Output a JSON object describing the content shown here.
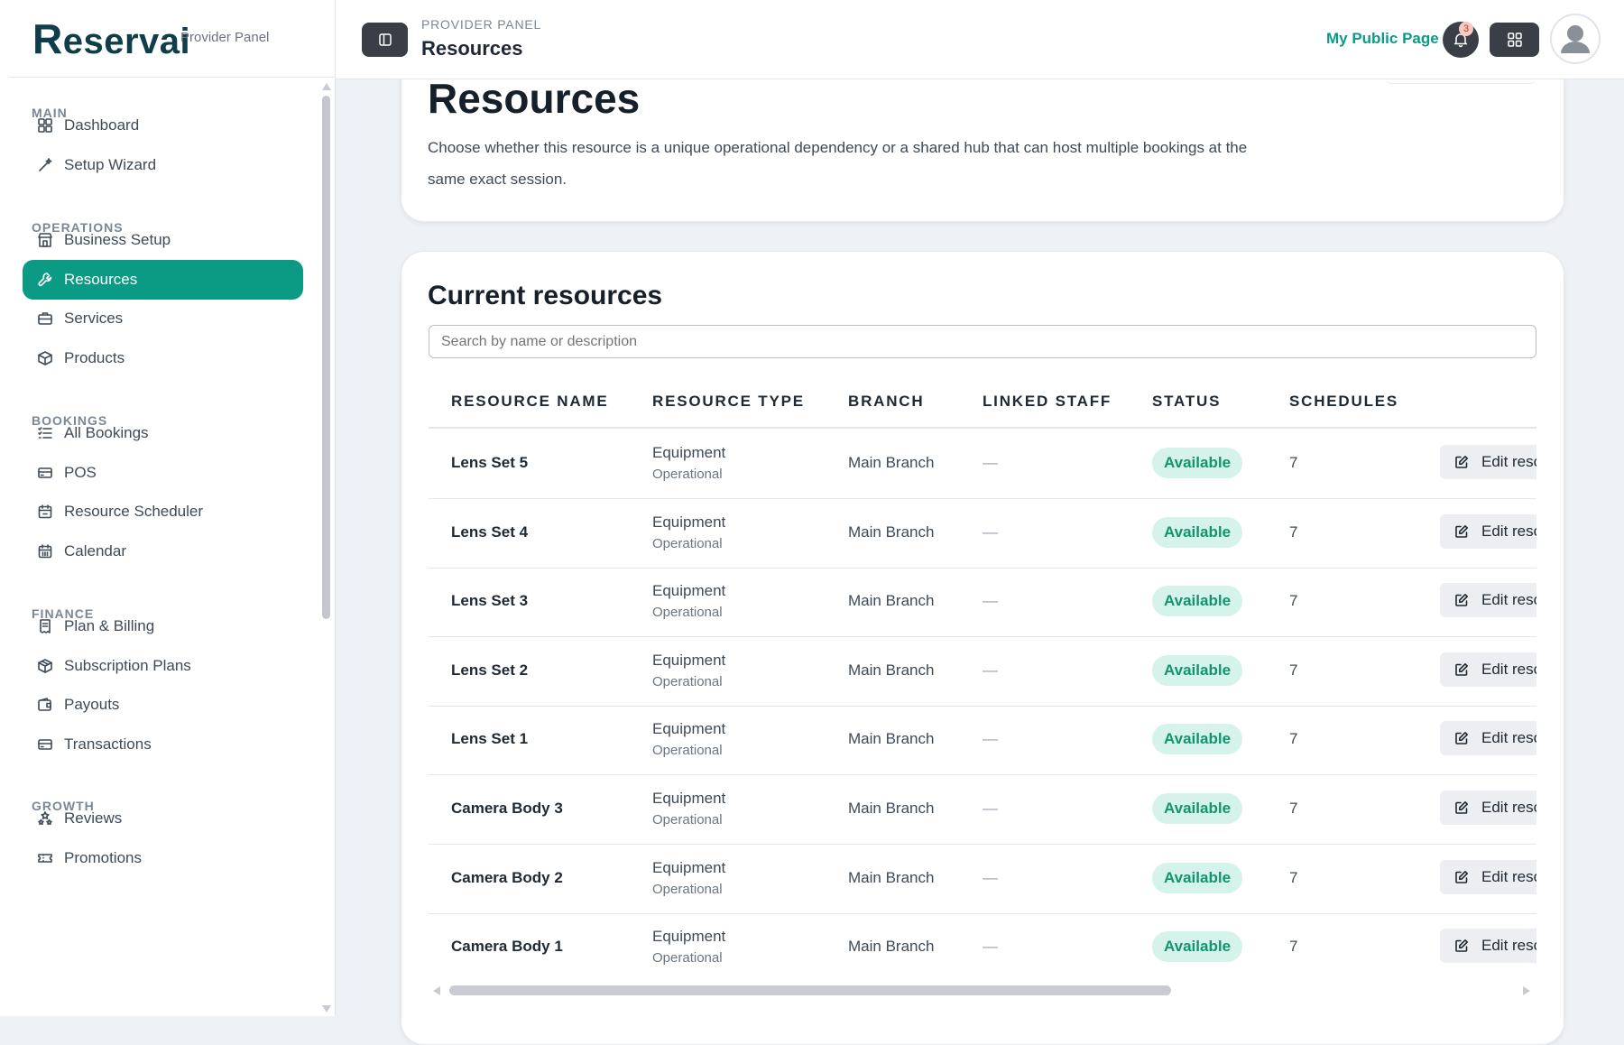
{
  "brand": {
    "logo_r": "R",
    "logo_rest": "eservai",
    "panel_label": "Provider Panel"
  },
  "sidebar": {
    "sections": [
      {
        "title": "MAIN",
        "items": [
          "Dashboard",
          "Setup Wizard"
        ]
      },
      {
        "title": "OPERATIONS",
        "items": [
          "Business Setup",
          "Resources",
          "Services",
          "Products"
        ]
      },
      {
        "title": "BOOKINGS",
        "items": [
          "All Bookings",
          "POS",
          "Resource Scheduler",
          "Calendar"
        ]
      },
      {
        "title": "FINANCE",
        "items": [
          "Plan & Billing",
          "Subscription Plans",
          "Payouts",
          "Transactions"
        ]
      },
      {
        "title": "GROWTH",
        "items": [
          "Reviews",
          "Promotions"
        ]
      }
    ],
    "active_item": "Resources"
  },
  "topbar": {
    "breadcrumb_small": "PROVIDER PANEL",
    "breadcrumb_title": "Resources",
    "public_link": "My Public Page",
    "notification_count": "3"
  },
  "intro": {
    "title": "Resources",
    "description": "Choose whether this resource is a unique operational dependency or a shared hub that can host multiple bookings at the same exact session."
  },
  "resources": {
    "title": "Current resources",
    "search_placeholder": "Search by name or description",
    "columns": [
      "RESOURCE NAME",
      "RESOURCE TYPE",
      "BRANCH",
      "LINKED STAFF",
      "STATUS",
      "SCHEDULES"
    ],
    "rows": [
      {
        "name": "Lens Set 5",
        "type": "Equipment",
        "subtype": "Operational",
        "branch": "Main Branch",
        "staff": "—",
        "status": "Available",
        "schedules": "7",
        "action": "Edit resource"
      },
      {
        "name": "Lens Set 4",
        "type": "Equipment",
        "subtype": "Operational",
        "branch": "Main Branch",
        "staff": "—",
        "status": "Available",
        "schedules": "7",
        "action": "Edit resource"
      },
      {
        "name": "Lens Set 3",
        "type": "Equipment",
        "subtype": "Operational",
        "branch": "Main Branch",
        "staff": "—",
        "status": "Available",
        "schedules": "7",
        "action": "Edit resource"
      },
      {
        "name": "Lens Set 2",
        "type": "Equipment",
        "subtype": "Operational",
        "branch": "Main Branch",
        "staff": "—",
        "status": "Available",
        "schedules": "7",
        "action": "Edit resource"
      },
      {
        "name": "Lens Set 1",
        "type": "Equipment",
        "subtype": "Operational",
        "branch": "Main Branch",
        "staff": "—",
        "status": "Available",
        "schedules": "7",
        "action": "Edit resource"
      },
      {
        "name": "Camera Body 3",
        "type": "Equipment",
        "subtype": "Operational",
        "branch": "Main Branch",
        "staff": "—",
        "status": "Available",
        "schedules": "7",
        "action": "Edit resource"
      },
      {
        "name": "Camera Body 2",
        "type": "Equipment",
        "subtype": "Operational",
        "branch": "Main Branch",
        "staff": "—",
        "status": "Available",
        "schedules": "7",
        "action": "Edit resource"
      },
      {
        "name": "Camera Body 1",
        "type": "Equipment",
        "subtype": "Operational",
        "branch": "Main Branch",
        "staff": "—",
        "status": "Available",
        "schedules": "7",
        "action": "Edit resource"
      }
    ]
  },
  "colors": {
    "accent": "#0b9a84",
    "status_bg": "#d5f3ea",
    "status_text": "#12946f",
    "dark_button": "#3a3f47"
  },
  "icons": {
    "Dashboard": "grid-icon",
    "Setup Wizard": "wand-icon",
    "Business Setup": "store-icon",
    "Resources": "tool-icon",
    "Services": "briefcase-icon",
    "Products": "box-icon",
    "All Bookings": "list-icon",
    "POS": "card-icon",
    "Resource Scheduler": "calendar-icon",
    "Calendar": "calendar-grid-icon",
    "Plan & Billing": "receipt-icon",
    "Subscription Plans": "package-icon",
    "Payouts": "wallet-icon",
    "Transactions": "card-icon",
    "Reviews": "stars-icon",
    "Promotions": "ticket-icon"
  }
}
